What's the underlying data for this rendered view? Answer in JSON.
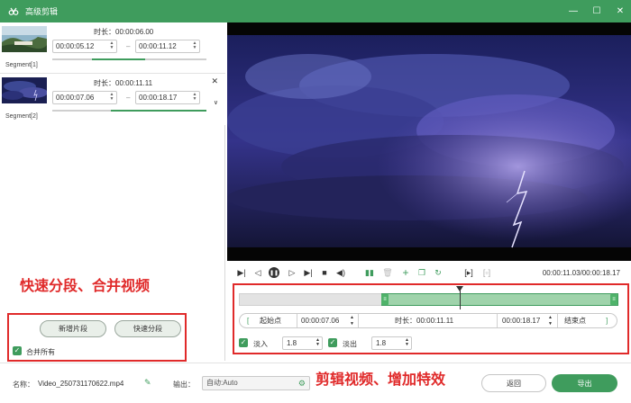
{
  "window": {
    "title": "高级剪辑"
  },
  "segments": [
    {
      "label": "Segment[1]",
      "duration": "时长：00:00:06.00",
      "start": "00:00:05.12",
      "end": "00:00:11.12",
      "range_start": 0.26,
      "range_end": 0.6
    },
    {
      "label": "Segment[2]",
      "duration": "时长：00:00:11.11",
      "start": "00:00:07.06",
      "end": "00:00:18.17",
      "range_start": 0.38,
      "range_end": 1.0
    }
  ],
  "left_actions": {
    "add_segment": "新增片段",
    "quick_split": "快速分段",
    "merge_all": "合并所有"
  },
  "annotations": {
    "left": "快速分段、合并视频",
    "bottom": "剪辑视频、增加特效"
  },
  "player": {
    "time": "00:00:11.03/00:00:18.17"
  },
  "edit": {
    "start_label": "起始点",
    "start_time": "00:00:07.06",
    "duration": "时长：00:00:11.11",
    "end_time": "00:00:18.17",
    "end_label": "结束点",
    "fade_in_label": "淡入",
    "fade_in_value": "1.8",
    "fade_out_label": "淡出",
    "fade_out_value": "1.8"
  },
  "bottom": {
    "name_label": "名称：",
    "file_name": "Video_250731170622.mp4",
    "output_label": "输出：",
    "output_value": "自动:Auto",
    "back_button": "返回",
    "export_button": "导出"
  },
  "colors": {
    "accent": "#3f9c5d",
    "annotation": "#e02a2a"
  }
}
